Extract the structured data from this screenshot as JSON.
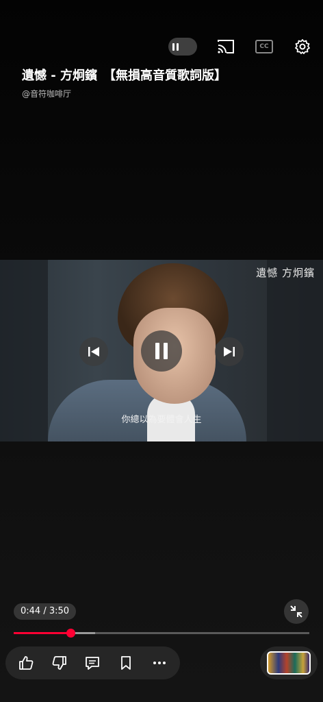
{
  "video": {
    "title": "遺憾 - 方炯鑌　【無損高音質歌詞版】",
    "channel": "@音符咖啡厅",
    "watermark": "遺憾 方炯鑌",
    "lyric": "你總以為要體會人生"
  },
  "player": {
    "time": "0:44 / 3:50",
    "current_seconds": 44,
    "duration_seconds": 230,
    "buffered_fraction": 0.275,
    "state": "playing"
  },
  "top_controls": {
    "autoplay_icon": "pause-toggle-icon",
    "cast_icon": "cast-icon",
    "captions_label": "CC",
    "settings_icon": "gear-icon"
  },
  "actions": [
    "like-icon",
    "dislike-icon",
    "comment-icon",
    "save-icon",
    "more-icon"
  ],
  "colors": {
    "progress": "#ff0033",
    "background": "#000000"
  }
}
